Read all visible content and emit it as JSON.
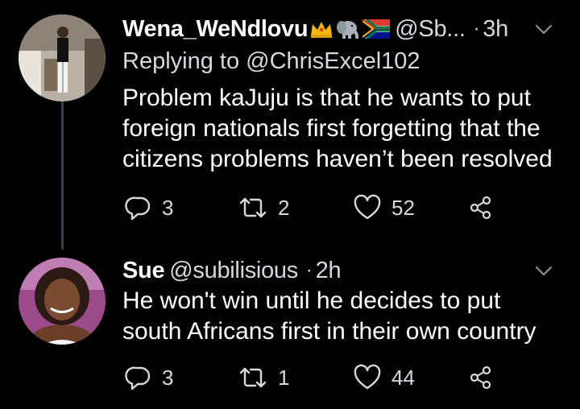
{
  "tweets": [
    {
      "name": "Wena_WeNdlovu",
      "handle": "@Sb...",
      "time": "3h",
      "replying": "Replying to @ChrisExcel102",
      "text": "Problem kaJuju is that he wants to put foreign nationals first forgetting that the citizens problems haven’t been resolved",
      "replies": "3",
      "retweets": "2",
      "likes": "52",
      "emojis": [
        "crown-emoji",
        "elephant-emoji",
        "south-africa-flag-emoji"
      ]
    },
    {
      "name": "Sue",
      "handle": "@subilisious",
      "time": "2h",
      "text": "He won't win until he decides to put south Africans first in their own country",
      "replies": "3",
      "retweets": "1",
      "likes": "44"
    }
  ],
  "colors": {
    "background": "#000000",
    "text": "#ffffff",
    "secondary": "#d6d9dc",
    "thread_line": "#3a3f44"
  },
  "icons": [
    "reply-icon",
    "retweet-icon",
    "like-icon",
    "share-icon",
    "chevron-down-icon"
  ]
}
